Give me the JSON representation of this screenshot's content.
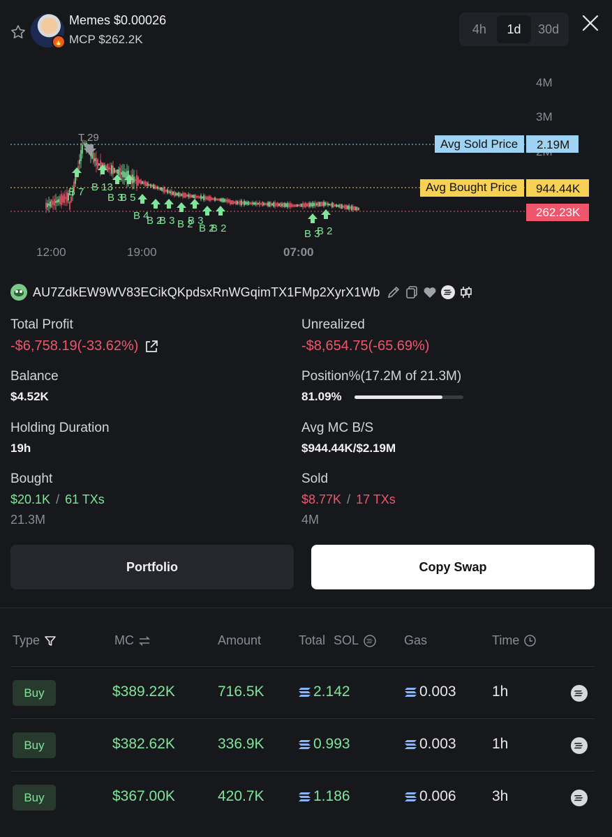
{
  "header": {
    "token_name": "Memes $0.00026",
    "token_mcp": "MCP $262.2K",
    "avatar_badge": "🔥",
    "intervals": [
      "4h",
      "1d",
      "30d"
    ],
    "active_interval": "1d"
  },
  "chart": {
    "y_ticks": [
      "4M",
      "3M",
      "2M"
    ],
    "x_ticks": [
      "12:00",
      "19:00",
      "07:00"
    ],
    "price_lines": [
      {
        "label": "Avg Sold Price",
        "value": "2.19M",
        "color": "#9fd3f3"
      },
      {
        "label": "Avg Bought Price",
        "value": "944.44K",
        "color": "#f7d154"
      },
      {
        "label": "",
        "value": "262.23K",
        "color": "#f0566b"
      }
    ],
    "markers": [
      "T 29",
      "B 7",
      "B 13",
      "B 3",
      "B 5",
      "B 4",
      "B 2",
      "B 3",
      "B 2",
      "B 3",
      "B 2",
      "B 2",
      "B 3",
      "B 2"
    ]
  },
  "wallet": {
    "address": "AU7ZdkEW9WV83ECikQKpdsxRnWGqimTX1FMp2XyrX1Wb"
  },
  "stats": {
    "total_profit_label": "Total Profit",
    "total_profit_value": "-$6,758.19(-33.62%)",
    "unrealized_label": "Unrealized",
    "unrealized_value": "-$8,654.75(-65.69%)",
    "balance_label": "Balance",
    "balance_value": "$4.52K",
    "position_label": "Position%(17.2M of 21.3M)",
    "position_value": "81.09%",
    "position_fraction": 0.8109,
    "holding_label": "Holding Duration",
    "holding_value": "19h",
    "avg_mc_label": "Avg MC B/S",
    "avg_mc_value": "$944.44K/$2.19M",
    "bought_label": "Bought",
    "bought_usd": "$20.1K",
    "bought_sep": "/",
    "bought_txs": "61 TXs",
    "bought_amount": "21.3M",
    "sold_label": "Sold",
    "sold_usd": "$8.77K",
    "sold_sep": "/",
    "sold_txs": "17 TXs",
    "sold_amount": "4M"
  },
  "buttons": {
    "portfolio": "Portfolio",
    "copy_swap": "Copy Swap"
  },
  "table": {
    "headers": {
      "type": "Type",
      "mc": "MC",
      "amount": "Amount",
      "total": "Total",
      "sol": "SOL",
      "gas": "Gas",
      "time": "Time"
    },
    "rows": [
      {
        "type": "Buy",
        "mc": "$389.22K",
        "amount": "716.5K",
        "total": "2.142",
        "gas": "0.003",
        "time": "1h"
      },
      {
        "type": "Buy",
        "mc": "$382.62K",
        "amount": "336.9K",
        "total": "0.993",
        "gas": "0.003",
        "time": "1h"
      },
      {
        "type": "Buy",
        "mc": "$367.00K",
        "amount": "420.7K",
        "total": "1.186",
        "gas": "0.006",
        "time": "3h"
      }
    ]
  },
  "colors": {
    "background": "#17181c",
    "positive": "#7ee59a",
    "negative": "#f0566b",
    "muted": "#8b8d94"
  }
}
